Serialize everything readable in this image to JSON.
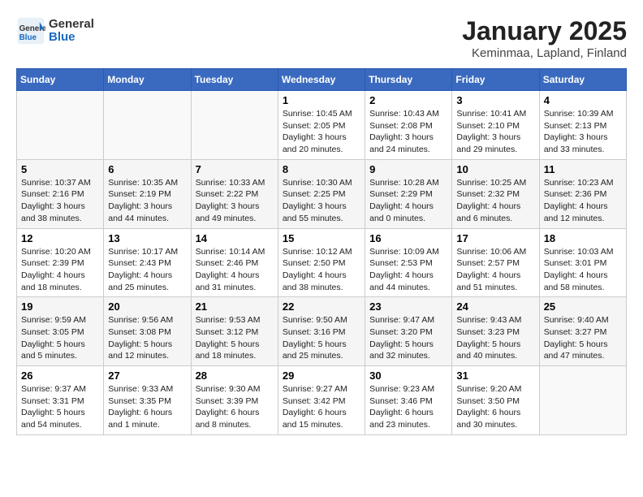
{
  "header": {
    "logo_general": "General",
    "logo_blue": "Blue",
    "month": "January 2025",
    "location": "Keminmaa, Lapland, Finland"
  },
  "days_of_week": [
    "Sunday",
    "Monday",
    "Tuesday",
    "Wednesday",
    "Thursday",
    "Friday",
    "Saturday"
  ],
  "weeks": [
    [
      {
        "num": "",
        "info": ""
      },
      {
        "num": "",
        "info": ""
      },
      {
        "num": "",
        "info": ""
      },
      {
        "num": "1",
        "info": "Sunrise: 10:45 AM\nSunset: 2:05 PM\nDaylight: 3 hours and 20 minutes."
      },
      {
        "num": "2",
        "info": "Sunrise: 10:43 AM\nSunset: 2:08 PM\nDaylight: 3 hours and 24 minutes."
      },
      {
        "num": "3",
        "info": "Sunrise: 10:41 AM\nSunset: 2:10 PM\nDaylight: 3 hours and 29 minutes."
      },
      {
        "num": "4",
        "info": "Sunrise: 10:39 AM\nSunset: 2:13 PM\nDaylight: 3 hours and 33 minutes."
      }
    ],
    [
      {
        "num": "5",
        "info": "Sunrise: 10:37 AM\nSunset: 2:16 PM\nDaylight: 3 hours and 38 minutes."
      },
      {
        "num": "6",
        "info": "Sunrise: 10:35 AM\nSunset: 2:19 PM\nDaylight: 3 hours and 44 minutes."
      },
      {
        "num": "7",
        "info": "Sunrise: 10:33 AM\nSunset: 2:22 PM\nDaylight: 3 hours and 49 minutes."
      },
      {
        "num": "8",
        "info": "Sunrise: 10:30 AM\nSunset: 2:25 PM\nDaylight: 3 hours and 55 minutes."
      },
      {
        "num": "9",
        "info": "Sunrise: 10:28 AM\nSunset: 2:29 PM\nDaylight: 4 hours and 0 minutes."
      },
      {
        "num": "10",
        "info": "Sunrise: 10:25 AM\nSunset: 2:32 PM\nDaylight: 4 hours and 6 minutes."
      },
      {
        "num": "11",
        "info": "Sunrise: 10:23 AM\nSunset: 2:36 PM\nDaylight: 4 hours and 12 minutes."
      }
    ],
    [
      {
        "num": "12",
        "info": "Sunrise: 10:20 AM\nSunset: 2:39 PM\nDaylight: 4 hours and 18 minutes."
      },
      {
        "num": "13",
        "info": "Sunrise: 10:17 AM\nSunset: 2:43 PM\nDaylight: 4 hours and 25 minutes."
      },
      {
        "num": "14",
        "info": "Sunrise: 10:14 AM\nSunset: 2:46 PM\nDaylight: 4 hours and 31 minutes."
      },
      {
        "num": "15",
        "info": "Sunrise: 10:12 AM\nSunset: 2:50 PM\nDaylight: 4 hours and 38 minutes."
      },
      {
        "num": "16",
        "info": "Sunrise: 10:09 AM\nSunset: 2:53 PM\nDaylight: 4 hours and 44 minutes."
      },
      {
        "num": "17",
        "info": "Sunrise: 10:06 AM\nSunset: 2:57 PM\nDaylight: 4 hours and 51 minutes."
      },
      {
        "num": "18",
        "info": "Sunrise: 10:03 AM\nSunset: 3:01 PM\nDaylight: 4 hours and 58 minutes."
      }
    ],
    [
      {
        "num": "19",
        "info": "Sunrise: 9:59 AM\nSunset: 3:05 PM\nDaylight: 5 hours and 5 minutes."
      },
      {
        "num": "20",
        "info": "Sunrise: 9:56 AM\nSunset: 3:08 PM\nDaylight: 5 hours and 12 minutes."
      },
      {
        "num": "21",
        "info": "Sunrise: 9:53 AM\nSunset: 3:12 PM\nDaylight: 5 hours and 18 minutes."
      },
      {
        "num": "22",
        "info": "Sunrise: 9:50 AM\nSunset: 3:16 PM\nDaylight: 5 hours and 25 minutes."
      },
      {
        "num": "23",
        "info": "Sunrise: 9:47 AM\nSunset: 3:20 PM\nDaylight: 5 hours and 32 minutes."
      },
      {
        "num": "24",
        "info": "Sunrise: 9:43 AM\nSunset: 3:23 PM\nDaylight: 5 hours and 40 minutes."
      },
      {
        "num": "25",
        "info": "Sunrise: 9:40 AM\nSunset: 3:27 PM\nDaylight: 5 hours and 47 minutes."
      }
    ],
    [
      {
        "num": "26",
        "info": "Sunrise: 9:37 AM\nSunset: 3:31 PM\nDaylight: 5 hours and 54 minutes."
      },
      {
        "num": "27",
        "info": "Sunrise: 9:33 AM\nSunset: 3:35 PM\nDaylight: 6 hours and 1 minute."
      },
      {
        "num": "28",
        "info": "Sunrise: 9:30 AM\nSunset: 3:39 PM\nDaylight: 6 hours and 8 minutes."
      },
      {
        "num": "29",
        "info": "Sunrise: 9:27 AM\nSunset: 3:42 PM\nDaylight: 6 hours and 15 minutes."
      },
      {
        "num": "30",
        "info": "Sunrise: 9:23 AM\nSunset: 3:46 PM\nDaylight: 6 hours and 23 minutes."
      },
      {
        "num": "31",
        "info": "Sunrise: 9:20 AM\nSunset: 3:50 PM\nDaylight: 6 hours and 30 minutes."
      },
      {
        "num": "",
        "info": ""
      }
    ]
  ]
}
